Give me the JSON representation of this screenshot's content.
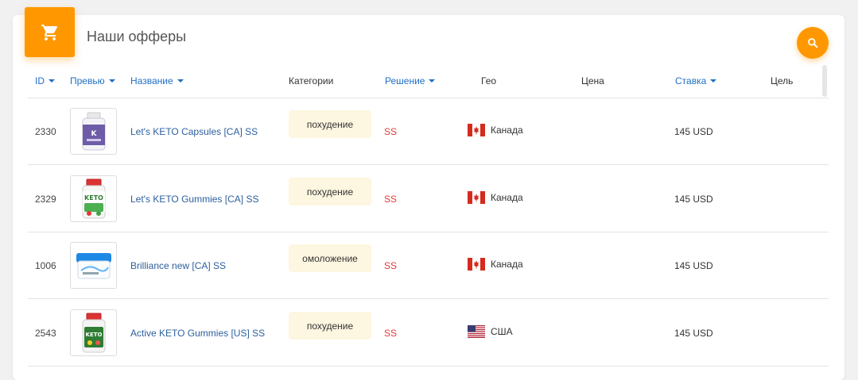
{
  "header": {
    "title": "Наши офферы",
    "accent": "#ff9800"
  },
  "table": {
    "columns": {
      "id": "ID",
      "preview": "Превью",
      "name": "Название",
      "categories": "Категории",
      "decision": "Решение",
      "geo": "Гео",
      "price": "Цена",
      "rate": "Ставка",
      "goal": "Цель"
    },
    "rows": [
      {
        "id": "2330",
        "thumb": "keto-capsules-bottle",
        "name": "Let's KETO Capsules [CA] SS",
        "category": "похудение",
        "decision": "SS",
        "flag": "canada-flag",
        "geo": "Канада",
        "rate": "145 USD"
      },
      {
        "id": "2329",
        "thumb": "keto-gummies-bottle",
        "name": "Let's KETO Gummies [CA] SS",
        "category": "похудение",
        "decision": "SS",
        "flag": "canada-flag",
        "geo": "Канада",
        "rate": "145 USD"
      },
      {
        "id": "1006",
        "thumb": "cream-jar",
        "name": "Brilliance new [CA] SS",
        "category": "омоложение",
        "decision": "SS",
        "flag": "canada-flag",
        "geo": "Канада",
        "rate": "145 USD"
      },
      {
        "id": "2543",
        "thumb": "active-keto-gummies-bottle",
        "name": "Active KETO Gummies [US] SS",
        "category": "похудение",
        "decision": "SS",
        "flag": "usa-flag",
        "geo": "США",
        "rate": "145 USD"
      }
    ]
  }
}
